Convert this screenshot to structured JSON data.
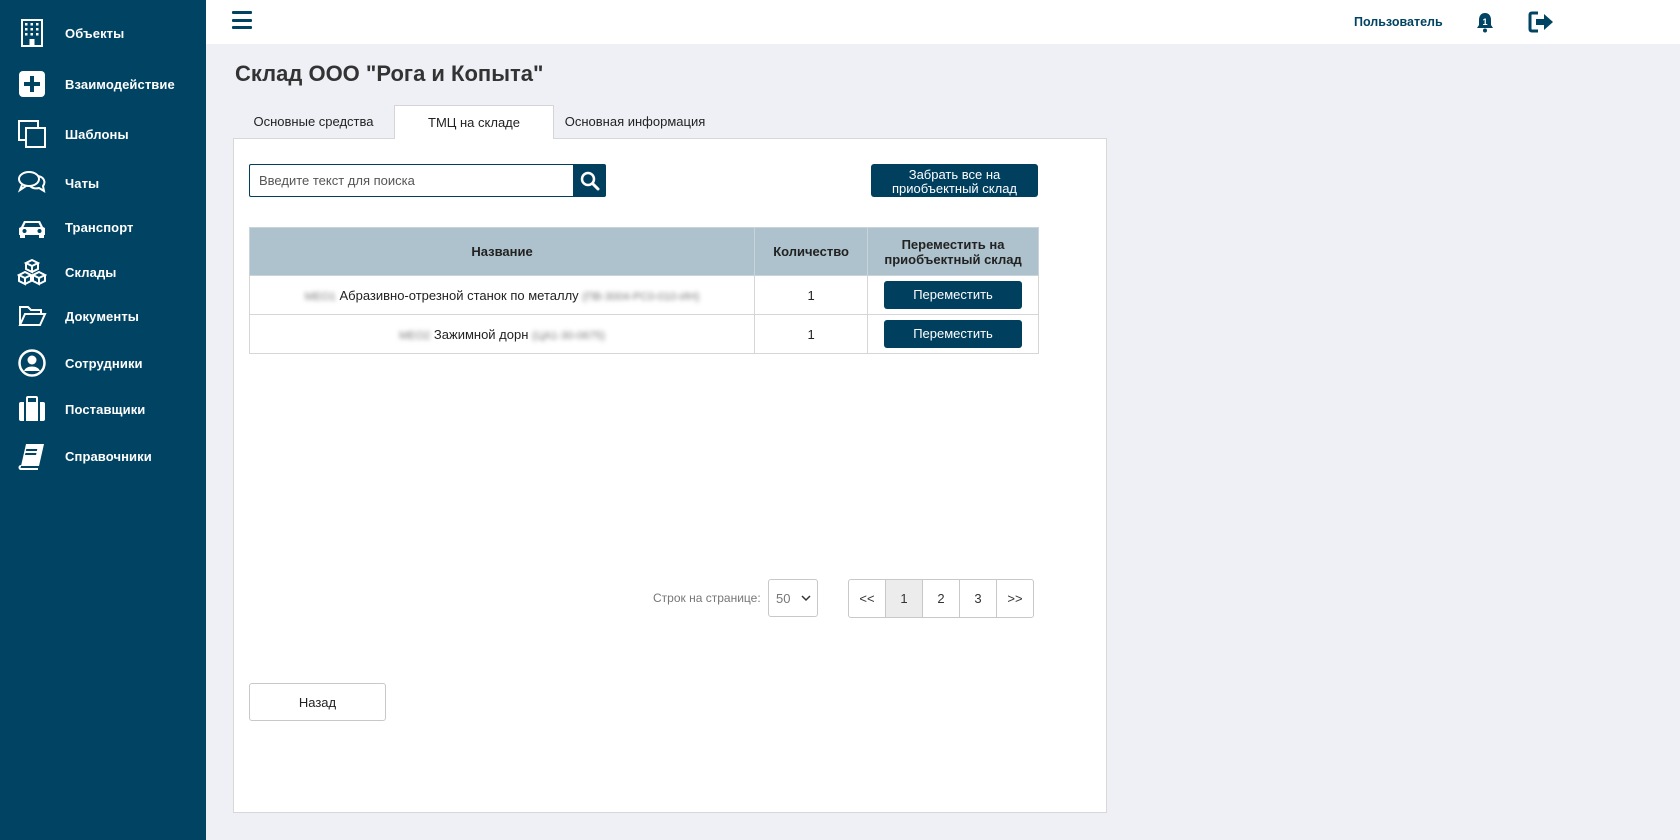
{
  "sidebar": {
    "items": [
      {
        "label": "Объекты",
        "icon": "building-icon"
      },
      {
        "label": "Взаимодействие",
        "icon": "plus-square-icon"
      },
      {
        "label": "Шаблоны",
        "icon": "copy-icon"
      },
      {
        "label": "Чаты",
        "icon": "chat-bubbles-icon"
      },
      {
        "label": "Транспорт",
        "icon": "car-icon"
      },
      {
        "label": "Склады",
        "icon": "boxes-icon"
      },
      {
        "label": "Документы",
        "icon": "folder-open-icon"
      },
      {
        "label": "Сотрудники",
        "icon": "user-circle-icon"
      },
      {
        "label": "Поставщики",
        "icon": "briefcase-icon"
      },
      {
        "label": "Справочники",
        "icon": "book-icon"
      }
    ]
  },
  "header": {
    "user": "Пользователь",
    "notifications_count": "1"
  },
  "page": {
    "title": "Склад ООО \"Рога и Копыта\""
  },
  "tabs": [
    {
      "label": "Основные средства",
      "active": false
    },
    {
      "label": "ТМЦ на складе",
      "active": true
    },
    {
      "label": "Основная информация",
      "active": false
    }
  ],
  "search": {
    "placeholder": "Введите текст для поиска",
    "value": ""
  },
  "actions": {
    "take_all_line1": "Забрать все на",
    "take_all_line2": "приобъектный склад"
  },
  "table": {
    "headers": {
      "name": "Название",
      "qty": "Количество",
      "move_line1": "Переместить на",
      "move_line2": "приобъектный склад"
    },
    "rows": [
      {
        "prefix": "МЕО1",
        "name": "Абразивно-отрезной станок по металлу",
        "suffix": "(ПВ-3004-РС0-010-ИН)",
        "qty": "1",
        "action": "Переместить"
      },
      {
        "prefix": "МЕО2",
        "name": "Зажимной дорн",
        "suffix": "(ЦА1-30-0675)",
        "qty": "1",
        "action": "Переместить"
      }
    ]
  },
  "pagination": {
    "rows_label": "Строк на странице:",
    "rows_value": "50",
    "first": "<<",
    "pages": [
      "1",
      "2",
      "3"
    ],
    "active_page": "1",
    "last": ">>"
  },
  "footer": {
    "back": "Назад"
  },
  "colors": {
    "sidebar_bg": "#004362",
    "accent": "#003f5e",
    "table_header_bg": "#adc2cc",
    "page_bg": "#eef0f6"
  }
}
